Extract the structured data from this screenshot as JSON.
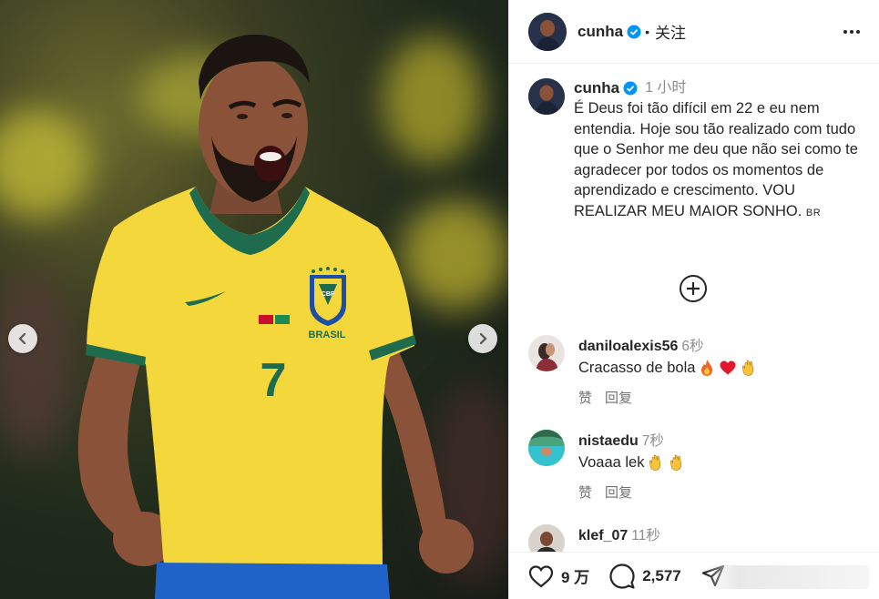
{
  "post": {
    "username": "cunha",
    "follow_label": "关注",
    "dot": "•"
  },
  "caption": {
    "username": "cunha",
    "time": "1 小时",
    "text": "É Deus foi tão difícil em 22 e eu nem entendia. Hoje sou tão realizado com tudo que o Senhor me deu que não sei como te agradecer por todos os momentos de aprendizado e crescimento. VOU REALIZAR MEU MAIOR SONHO.",
    "flag_text": "BR"
  },
  "comments": [
    {
      "username": "daniloalexis56",
      "time": "6秒",
      "text": "Cracasso de bola",
      "emojis": [
        "fire",
        "red-heart",
        "clapping-hands"
      ],
      "like_label": "赞",
      "reply_label": "回复"
    },
    {
      "username": "nistaedu",
      "time": "7秒",
      "text": "Voaaa lek",
      "emojis": [
        "clapping-hands",
        "clapping-hands"
      ],
      "like_label": "赞",
      "reply_label": "回复"
    },
    {
      "username": "klef_07",
      "time": "11秒"
    }
  ],
  "footer": {
    "likes": "9 万",
    "comments": "2,577"
  },
  "jersey": {
    "number": "7",
    "brand_text": "BRASIL",
    "crest_text": "CBF"
  },
  "colors": {
    "jersey_yellow": "#f4d73a",
    "jersey_green": "#1e6b4e",
    "shorts_blue": "#1f63c9",
    "verified_blue": "#0095f6"
  }
}
